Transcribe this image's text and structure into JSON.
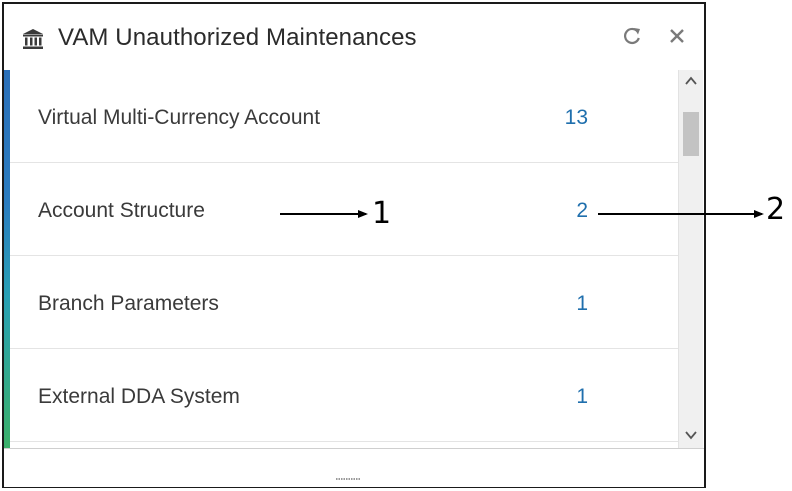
{
  "widget": {
    "title": "VAM Unauthorized Maintenances",
    "header_icon": "bank-icon",
    "actions": [
      {
        "name": "refresh",
        "icon": "refresh-icon"
      },
      {
        "name": "close",
        "icon": "close-icon"
      }
    ]
  },
  "rows": [
    {
      "label": "Virtual Multi-Currency Account",
      "count": "13"
    },
    {
      "label": "Account Structure",
      "count": "2"
    },
    {
      "label": "Branch Parameters",
      "count": "1"
    },
    {
      "label": "External DDA System",
      "count": "1"
    }
  ],
  "annotations": {
    "callout_1": "1",
    "callout_2": "2"
  },
  "colors": {
    "count_text": "#1f6fad",
    "label_text": "#3a3a3a",
    "border": "#1a1a1a",
    "accent_top": "#2a6fb8",
    "accent_bottom": "#3bb06a"
  }
}
